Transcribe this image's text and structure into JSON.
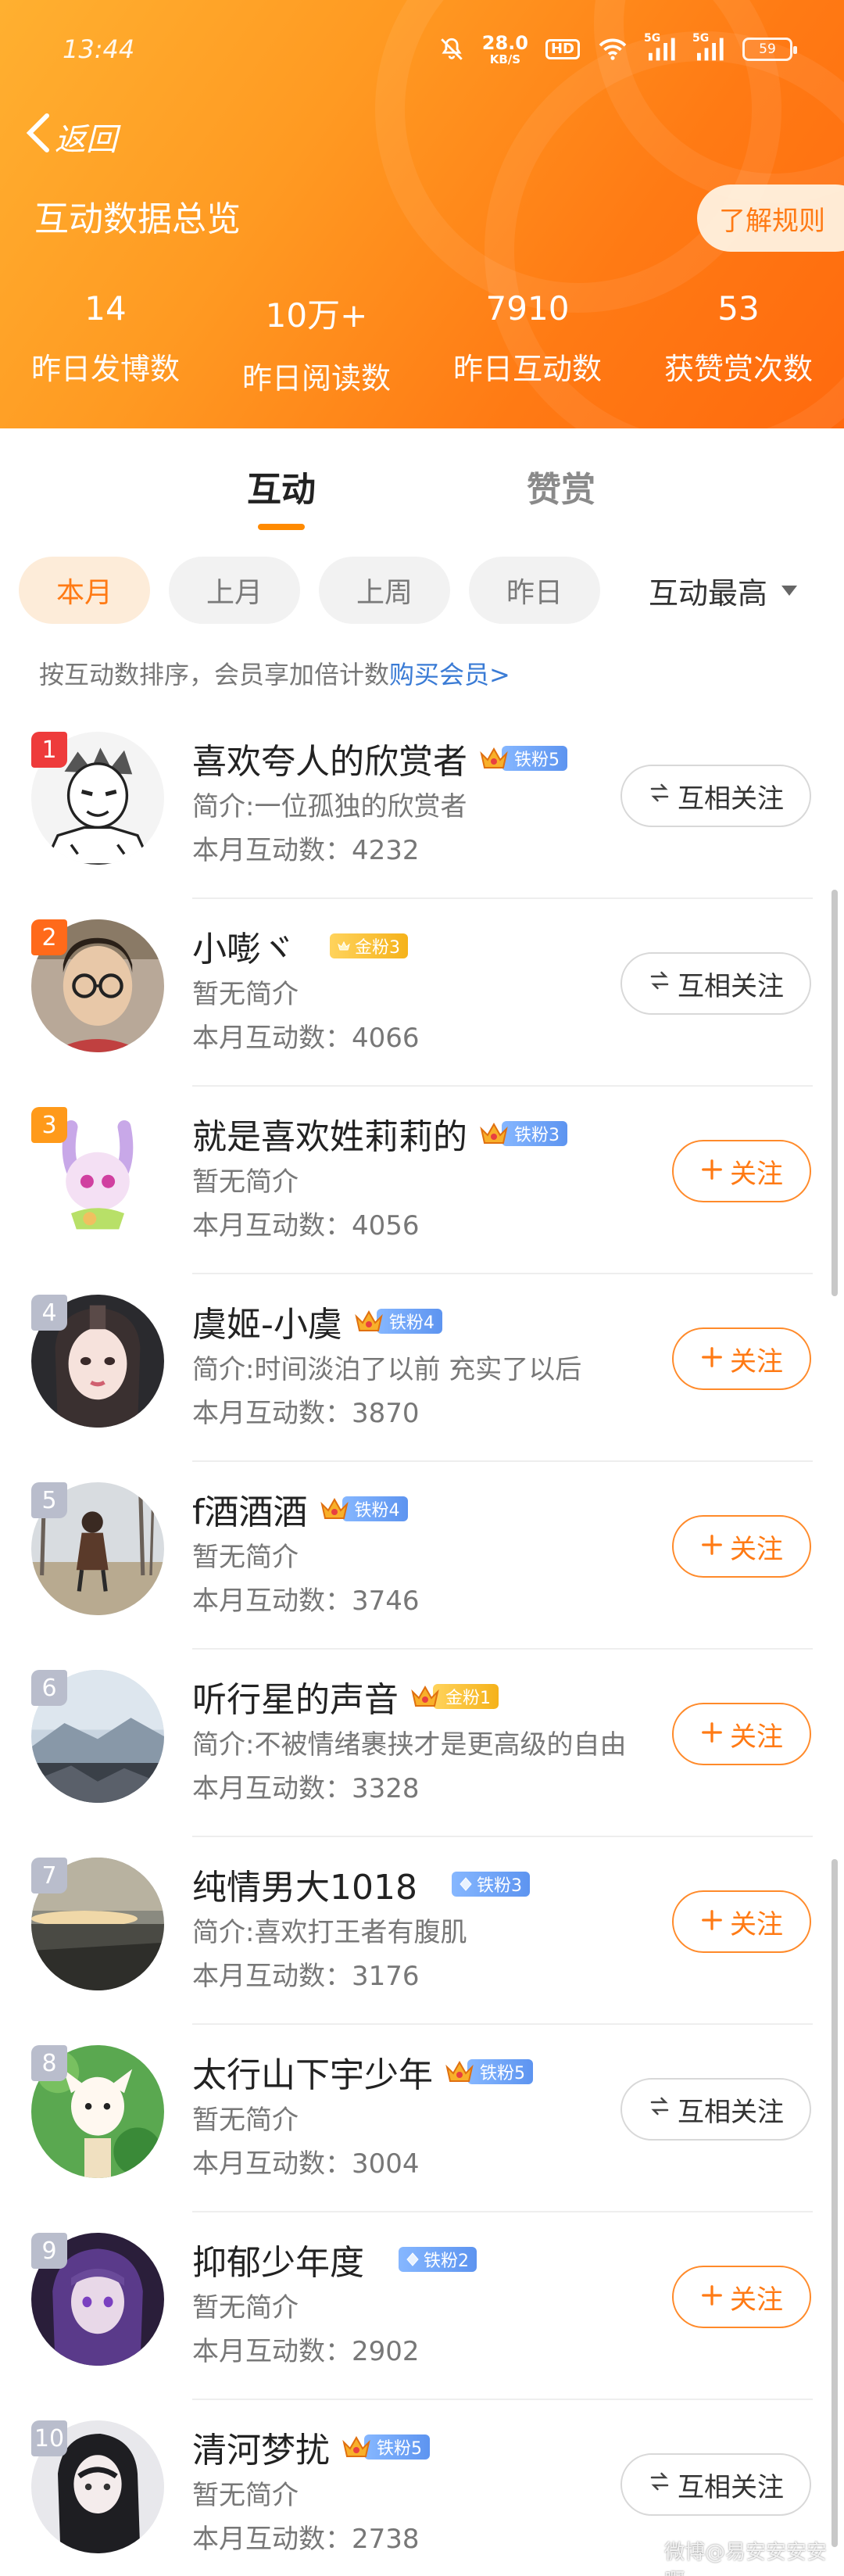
{
  "status_bar": {
    "time": "13:44",
    "net_speed": "28.0",
    "net_unit": "KB/S",
    "hd_label": "HD",
    "signal1": "5G",
    "signal2": "5G",
    "battery": "59"
  },
  "header": {
    "back_label": "返回",
    "title": "互动数据总览",
    "rules_button": "了解规则",
    "stats": [
      {
        "value": "14",
        "label": "昨日发博数"
      },
      {
        "value": "10万+",
        "label": "昨日阅读数"
      },
      {
        "value": "7910",
        "label": "昨日互动数"
      },
      {
        "value": "53",
        "label": "获赞赏次数"
      }
    ]
  },
  "tabs": [
    {
      "label": "互动",
      "active": true
    },
    {
      "label": "赞赏",
      "active": false
    }
  ],
  "filters": {
    "chips": [
      "本月",
      "上月",
      "上周",
      "昨日"
    ],
    "active_chip": "本月",
    "sort_label": "互动最高"
  },
  "hint": {
    "text": "按互动数排序，会员享加倍计数",
    "link": "购买会员>"
  },
  "list": [
    {
      "rank": "1",
      "name": "喜欢夸人的欣赏者",
      "badge": "铁粉5",
      "badge_type": "iron",
      "badge_icon": "crown-icon",
      "bio": "简介:一位孤独的欣赏者",
      "count": "本月互动数：4232",
      "action": "mutual"
    },
    {
      "rank": "2",
      "name": "小嘭ヾ",
      "badge": "金粉3",
      "badge_type": "gold",
      "badge_icon": "gold-icon",
      "bio": "暂无简介",
      "count": "本月互动数：4066",
      "action": "mutual"
    },
    {
      "rank": "3",
      "name": "就是喜欢姓莉莉的",
      "badge": "铁粉3",
      "badge_type": "iron",
      "badge_icon": "crown-icon",
      "bio": "暂无简介",
      "count": "本月互动数：4056",
      "action": "follow"
    },
    {
      "rank": "4",
      "name": "虞姬-小虞",
      "badge": "铁粉4",
      "badge_type": "iron",
      "badge_icon": "crown-icon",
      "bio": "简介:时间淡泊了以前 充实了以后",
      "count": "本月互动数：3870",
      "action": "follow"
    },
    {
      "rank": "5",
      "name": "f酒酒酒",
      "badge": "铁粉4",
      "badge_type": "iron",
      "badge_icon": "crown-icon",
      "bio": "暂无简介",
      "count": "本月互动数：3746",
      "action": "follow"
    },
    {
      "rank": "6",
      "name": "听行星的声音",
      "badge": "金粉1",
      "badge_type": "gold",
      "badge_icon": "crown-icon",
      "bio": "简介:不被情绪裹挟才是更高级的自由",
      "count": "本月互动数：3328",
      "action": "follow"
    },
    {
      "rank": "7",
      "name": "纯情男大1018",
      "badge": "铁粉3",
      "badge_type": "iron",
      "badge_icon": "diamond-icon",
      "bio": "简介:喜欢打王者有腹肌",
      "count": "本月互动数：3176",
      "action": "follow"
    },
    {
      "rank": "8",
      "name": "太行山下宇少年",
      "badge": "铁粉5",
      "badge_type": "iron",
      "badge_icon": "crown-icon",
      "bio": "暂无简介",
      "count": "本月互动数：3004",
      "action": "mutual"
    },
    {
      "rank": "9",
      "name": "抑郁少年度",
      "badge": "铁粉2",
      "badge_type": "iron",
      "badge_icon": "diamond-icon",
      "bio": "暂无简介",
      "count": "本月互动数：2902",
      "action": "follow"
    },
    {
      "rank": "10",
      "name": "清河梦扰",
      "badge": "铁粉5",
      "badge_type": "iron",
      "badge_icon": "crown-icon",
      "bio": "暂无简介",
      "count": "本月互动数：2738",
      "action": "mutual"
    }
  ],
  "actions": {
    "mutual_label": "互相关注",
    "follow_label": "关注"
  },
  "watermark": "微博@易安安安安啊",
  "colors": {
    "accent": "#ff7a14",
    "header_start": "#ffb030",
    "header_end": "#ff6a0e",
    "link": "#3a7bd5",
    "rank1": "#ee3b3b",
    "rank2": "#ff6a1a",
    "rank3": "#ff9a1a",
    "rank_other": "#b9bdcc"
  }
}
